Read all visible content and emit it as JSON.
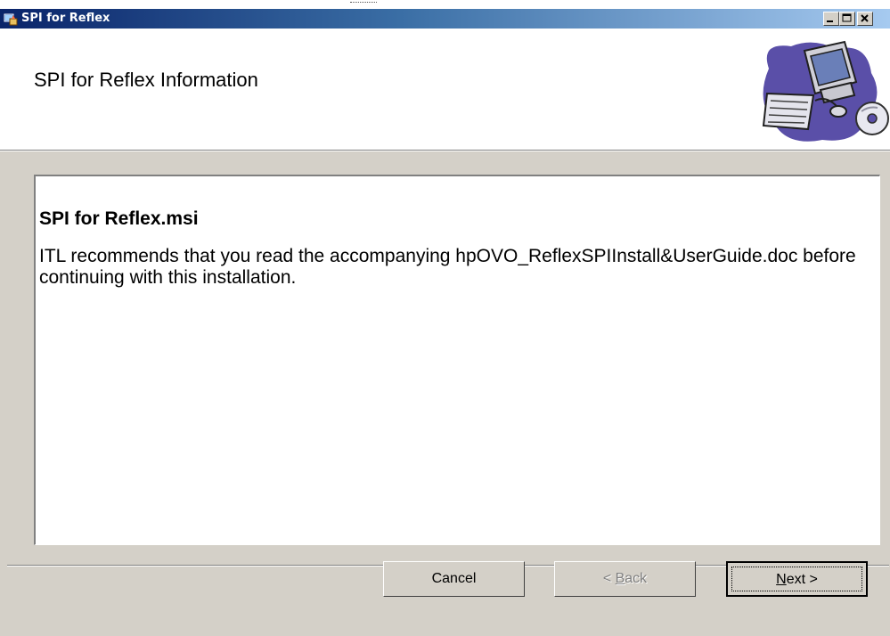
{
  "window": {
    "title": "SPI for Reflex",
    "controls": [
      "minimize-icon",
      "maximize-icon",
      "close-icon"
    ]
  },
  "header": {
    "title": "SPI for Reflex Information",
    "graphic": "computer-setup-icon"
  },
  "content": {
    "file_title": "SPI for Reflex.msi",
    "message": "ITL recommends that you read the accompanying hpOVO_ReflexSPIInstall&UserGuide.doc before continuing with this installation."
  },
  "buttons": {
    "cancel": "Cancel",
    "back_prefix": "< ",
    "back_mnemonic": "B",
    "back_rest": "ack",
    "next_mnemonic": "N",
    "next_rest": "ext >"
  },
  "colors": {
    "title_start": "#0a246a",
    "title_end": "#a6caf0",
    "dialog_bg": "#d4d0c8"
  }
}
